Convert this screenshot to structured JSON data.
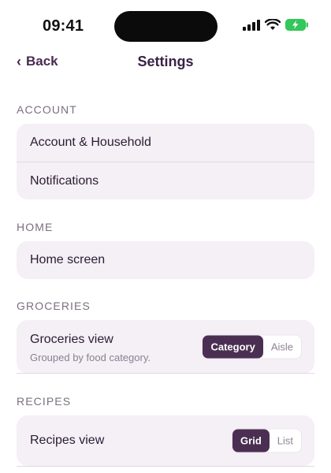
{
  "status_bar": {
    "time": "09:41"
  },
  "nav": {
    "back_label": "Back",
    "title": "Settings"
  },
  "sections": {
    "account": {
      "label": "ACCOUNT",
      "items": [
        "Account & Household",
        "Notifications"
      ]
    },
    "home": {
      "label": "HOME",
      "items": [
        "Home screen"
      ]
    },
    "groceries": {
      "label": "GROCERIES",
      "view_title": "Groceries view",
      "view_subtitle": "Grouped by food category.",
      "options": [
        "Category",
        "Aisle"
      ],
      "selected": "Category"
    },
    "recipes": {
      "label": "RECIPES",
      "view_title": "Recipes view",
      "options": [
        "Grid",
        "List"
      ],
      "selected": "Grid"
    }
  },
  "colors": {
    "accent": "#4a2f52",
    "card_bg": "#f5eff6",
    "section_label": "#7b6f80",
    "battery_green": "#34c759"
  }
}
